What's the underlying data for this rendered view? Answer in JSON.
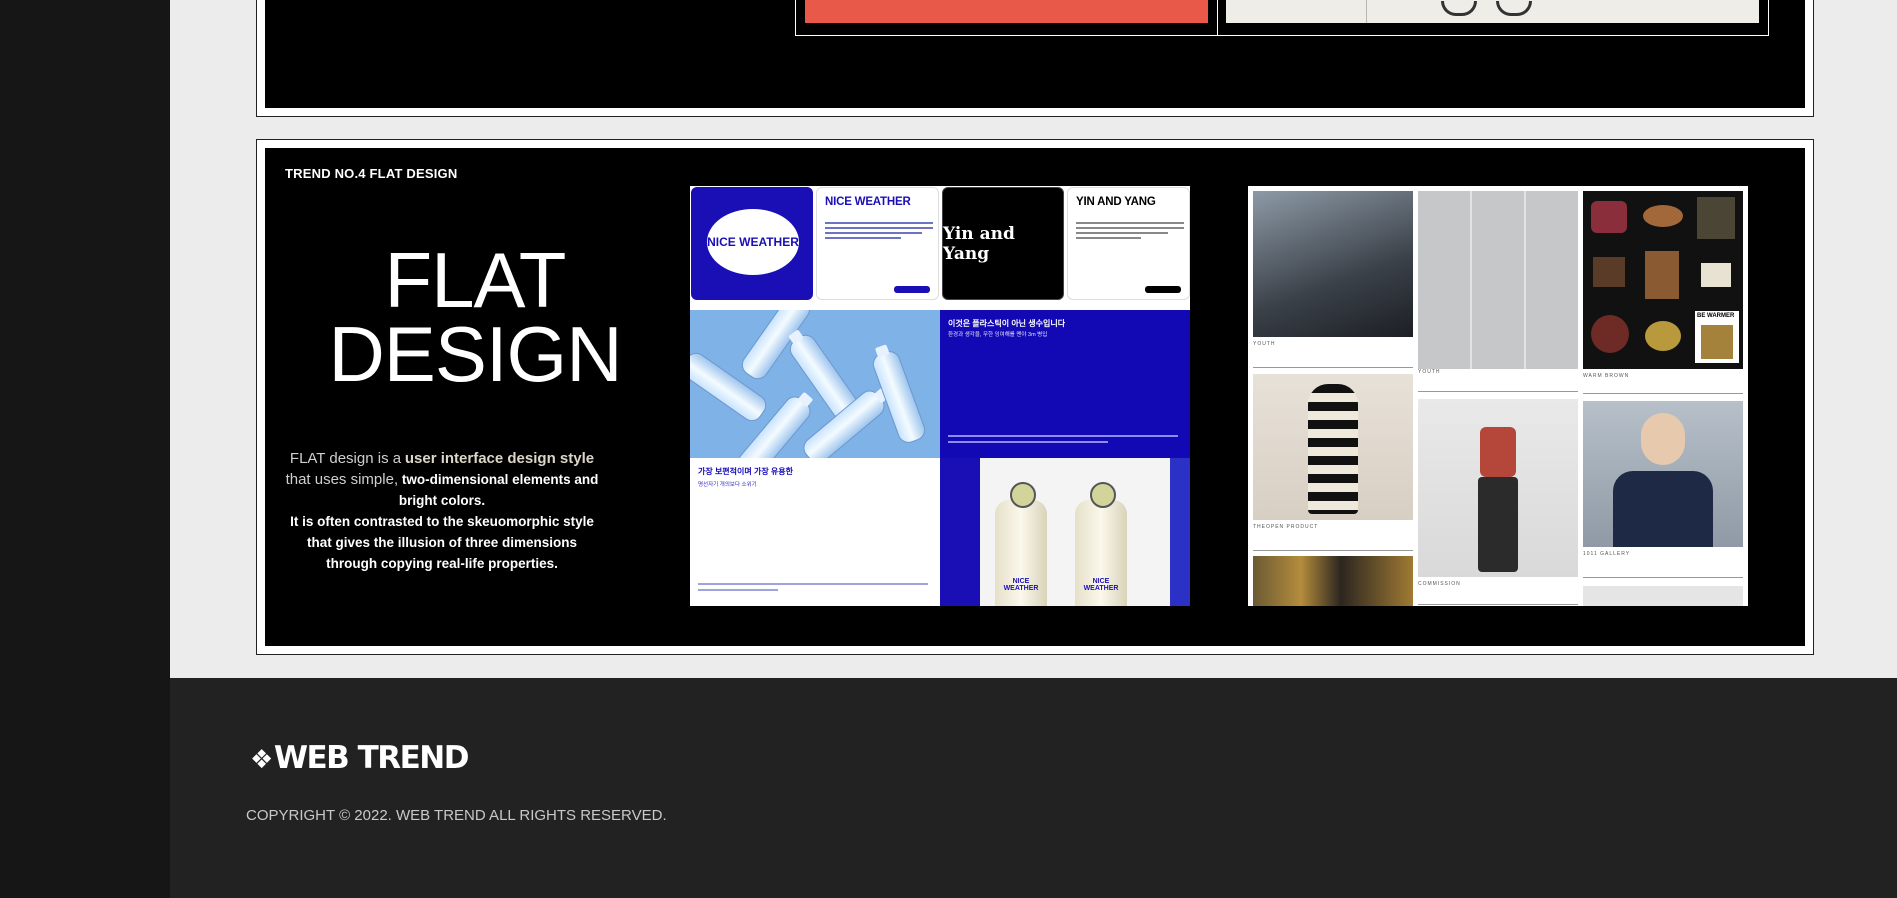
{
  "trend_section": {
    "label": "TREND NO.4 FLAT DESIGN",
    "title_line1": "FLAT",
    "title_line2": "DESIGN",
    "desc_part1": "FLAT design is a",
    "desc_part2": "user interface design style",
    "desc_part3": "that uses simple,",
    "desc_part4": "two-dimensional elements and bright colors.",
    "desc_part5": "It is often contrasted to the skeuomorphic style that gives the illusion of three dimensions through copying real-life properties."
  },
  "collage_nice_weather": {
    "logo_text": "NICE WEATHER",
    "card1_title": "NICE WEATHER",
    "card2_logo": "Yin and Yang",
    "card2_title": "YIN AND YANG",
    "korean_title": "이것은 플라스틱이 아닌 생수입니다",
    "korean_sub": "환경과 생각을, 무한 잉여해를 맨야 3m 병입",
    "korean_title2": "가장 보편적이며 가장 유용한",
    "korean_sub2": "명선자기 개의보다 소위기",
    "extinguisher_label": "NICE WEATHER"
  },
  "collage_fashion": {
    "captions": [
      "YOUTH",
      "YOUTH",
      "WARM BROWN",
      "THEOPEN PRODUCT",
      "COMMISSION",
      "1011 GALLERY",
      "BE WARMER"
    ]
  },
  "footer": {
    "logo_mark": "❖",
    "logo_text": "WEB TREND",
    "copyright": "COPYRIGHT © 2022. WEB TREND ALL RIGHTS RESERVED."
  },
  "colors": {
    "accent_blue": "#1a0fb5",
    "orange": "#e8594a",
    "footer_bg": "#222222",
    "sidebar_bg": "#161616"
  }
}
